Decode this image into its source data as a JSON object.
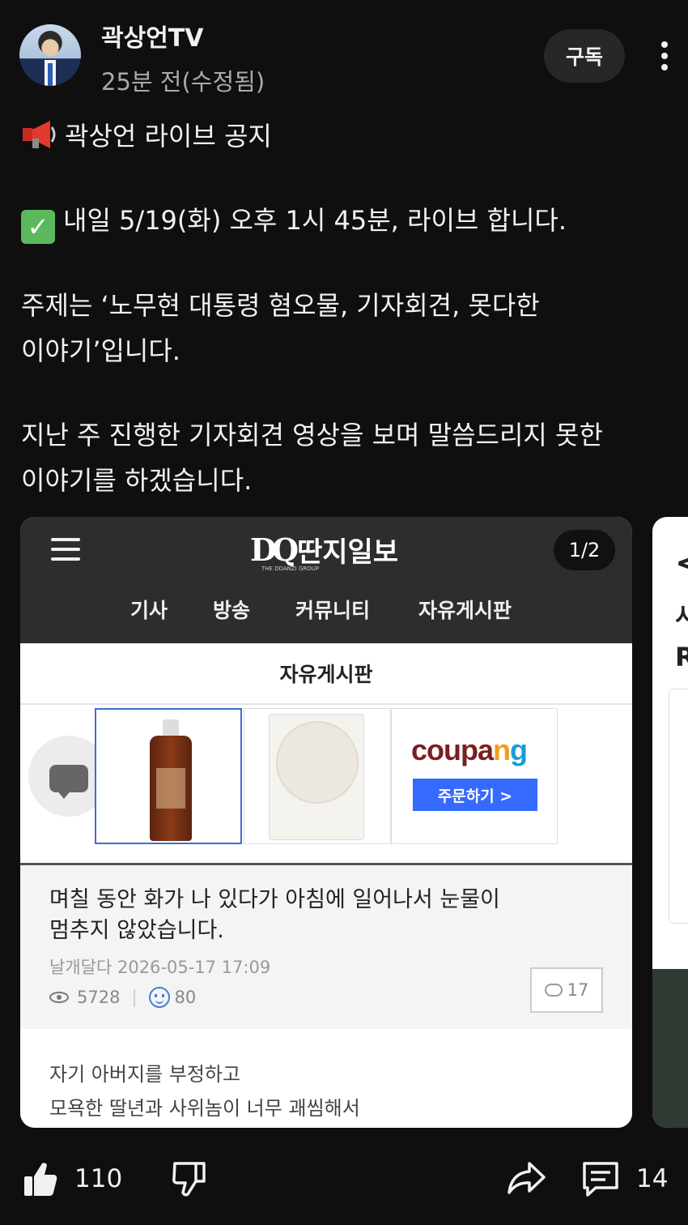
{
  "header": {
    "channel_name": "곽상언TV",
    "post_time": "25분 전(수정됨)",
    "subscribe_label": "구독"
  },
  "post": {
    "line1": "곽상언 라이브 공지",
    "line2": "내일 5/19(화) 오후 1시 45분, 라이브 합니다.",
    "line3a": "주제는 ‘노무현 대통령 혐오물, 기자회견, 못다한",
    "line3b": "이야기’입니다.",
    "line4a": "지난 주 진행한 기자회견 영상을 보며 말씀드리지 못한",
    "line4b": "이야기를 하겠습니다."
  },
  "carousel": {
    "page_counter": "1/2",
    "site": {
      "logo_mark": "DQ",
      "logo_name": "딴지일보",
      "logo_sub": "THE DDANZI GROUP",
      "nav": [
        "기사",
        "방송",
        "커뮤니티",
        "자유게시판"
      ],
      "board_title": "자유게시판"
    },
    "ad": {
      "coupang_c": "coupa",
      "coupang_n": "n",
      "coupang_g": "g",
      "button_label": "주문하기 >"
    },
    "article": {
      "title_line1": "며칠 동안 화가 나 있다가 아침에 일어나서 눈물이",
      "title_line2": "멈추지 않았습니다.",
      "author": "날개달다",
      "date": "2026-05-17 17:09",
      "views": "5728",
      "likes": "80",
      "comments": "17"
    },
    "article2": {
      "line1": "자기 아버지를 부정하고",
      "line2": "모욕한 딸년과 사위놈이 너무 괘씸해서"
    },
    "next_card": {
      "chevron": "<",
      "text1": "시",
      "text2": "R"
    }
  },
  "actions": {
    "like_count": "110",
    "comment_count": "14"
  },
  "colors": {
    "background": "#0f0f0f",
    "text": "#f1f1f1",
    "secondary_text": "#aaaaaa",
    "subscribe_bg": "#272727",
    "coupang_button": "#346aff"
  }
}
